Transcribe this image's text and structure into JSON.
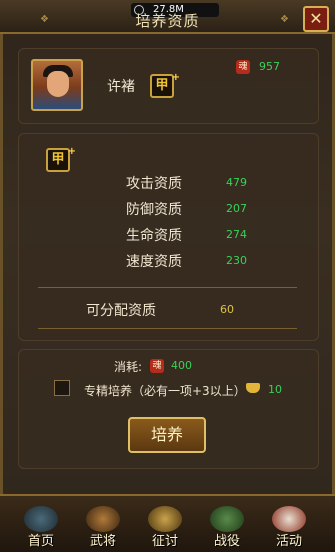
{
  "header": {
    "ram_text": "27.8M",
    "title": "培养资质",
    "close_glyph": "✕"
  },
  "hero": {
    "name": "许褚",
    "grade": "甲",
    "soul_label": "魂",
    "soul_amount": "957"
  },
  "quality": {
    "grade": "甲",
    "stats": [
      {
        "label": "攻击资质",
        "value": "479"
      },
      {
        "label": "防御资质",
        "value": "207"
      },
      {
        "label": "生命资质",
        "value": "274"
      },
      {
        "label": "速度资质",
        "value": "230"
      }
    ],
    "distributable_label": "可分配资质",
    "distributable_value": "60"
  },
  "training": {
    "cost_label": "消耗:",
    "cost_soul_label": "魂",
    "cost_amount": "400",
    "focus_label": "专精培养（必有一项+3以上）",
    "focus_cost": "10",
    "train_button": "培养"
  },
  "bottom_nav": [
    {
      "label": "首页",
      "icon": "home-icon"
    },
    {
      "label": "武将",
      "icon": "general-icon"
    },
    {
      "label": "征讨",
      "icon": "campaign-icon"
    },
    {
      "label": "战役",
      "icon": "battle-icon"
    },
    {
      "label": "活动",
      "icon": "event-icon"
    }
  ],
  "colors": {
    "accent_gold": "#c9a24a",
    "value_green": "#39d15a",
    "value_yellow": "#d9c34a",
    "soul_red": "#b52b1c"
  }
}
